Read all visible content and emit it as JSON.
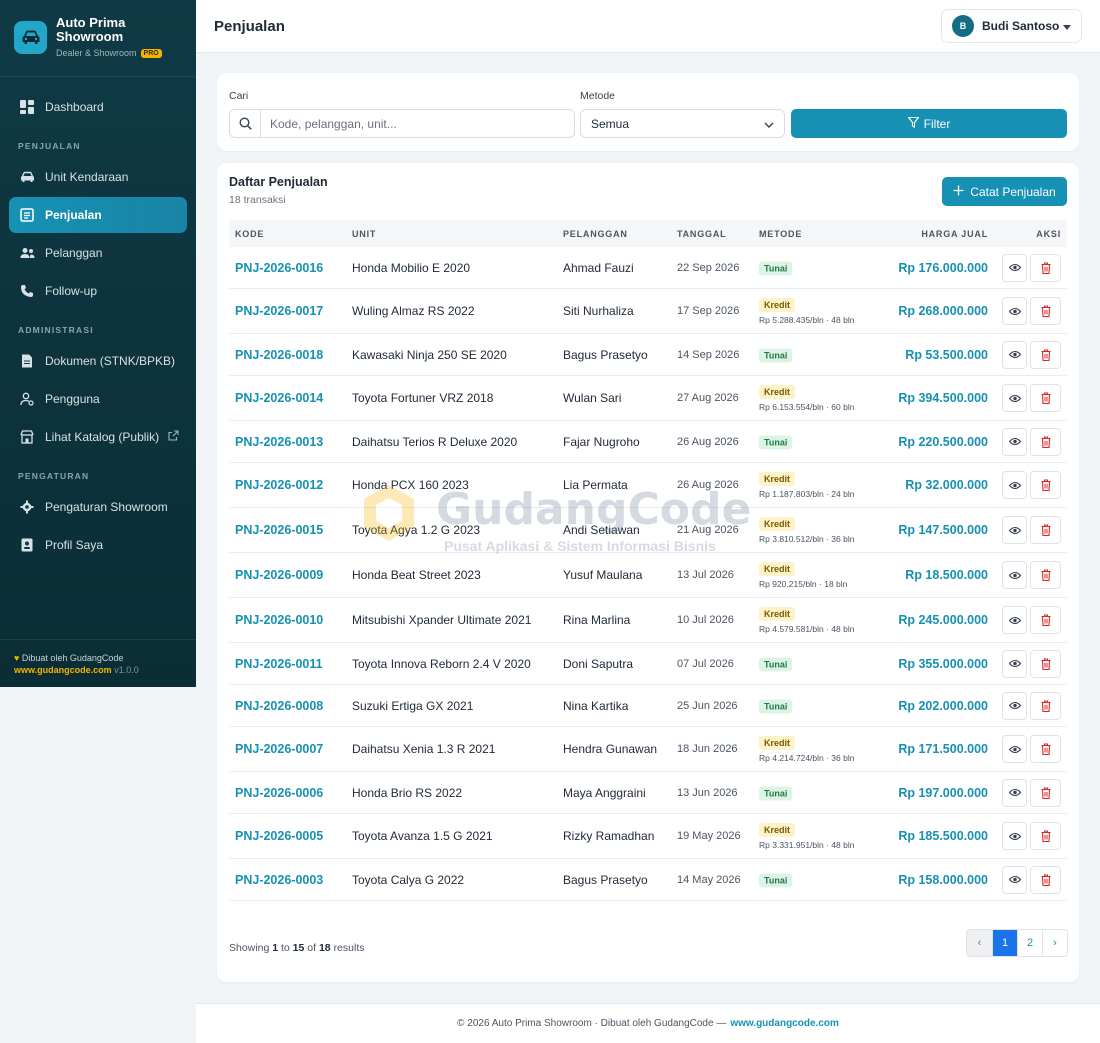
{
  "brand": {
    "name_line1": "Auto Prima",
    "name_line2": "Showroom",
    "subtitle": "Dealer & Showroom",
    "badge": "PRO",
    "icon": "car-icon"
  },
  "sidebar": {
    "dashboard": "Dashboard",
    "section_penjualan": "PENJUALAN",
    "unit_kendaraan": "Unit Kendaraan",
    "penjualan": "Penjualan",
    "pelanggan": "Pelanggan",
    "follow_up": "Follow-up",
    "section_administrasi": "ADMINISTRASI",
    "dokumen": "Dokumen (STNK/BPKB)",
    "pengguna": "Pengguna",
    "katalog": "Lihat Katalog (Publik)",
    "section_pengaturan": "PENGATURAN",
    "pengaturan_showroom": "Pengaturan Showroom",
    "profil": "Profil Saya",
    "footer_made": "Dibuat oleh GudangCode",
    "footer_link": "www.gudangcode.com",
    "footer_version": "v1.0.0"
  },
  "header": {
    "title": "Penjualan",
    "user_initial": "B",
    "user_name": "Budi Santoso"
  },
  "filter": {
    "search_label": "Cari",
    "search_placeholder": "Kode, pelanggan, unit...",
    "method_label": "Metode",
    "method_value": "Semua",
    "filter_button": "Filter"
  },
  "table": {
    "title": "Daftar Penjualan",
    "count": "18 transaksi",
    "add_button": "Catat Penjualan",
    "columns": {
      "kode": "KODE",
      "unit": "UNIT",
      "pelanggan": "PELANGGAN",
      "tanggal": "TANGGAL",
      "metode": "METODE",
      "harga": "HARGA JUAL",
      "aksi": "AKSI"
    },
    "rows": [
      {
        "kode": "PNJ-2026-0016",
        "unit": "Honda Mobilio E 2020",
        "pelanggan": "Ahmad Fauzi",
        "tanggal": "22 Sep 2026",
        "metode": "Tunai",
        "note": "",
        "harga": "Rp 176.000.000"
      },
      {
        "kode": "PNJ-2026-0017",
        "unit": "Wuling Almaz RS 2022",
        "pelanggan": "Siti Nurhaliza",
        "tanggal": "17 Sep 2026",
        "metode": "Kredit",
        "note": "Rp 5.288.435/bln · 48 bln",
        "harga": "Rp 268.000.000"
      },
      {
        "kode": "PNJ-2026-0018",
        "unit": "Kawasaki Ninja 250 SE 2020",
        "pelanggan": "Bagus Prasetyo",
        "tanggal": "14 Sep 2026",
        "metode": "Tunai",
        "note": "",
        "harga": "Rp 53.500.000"
      },
      {
        "kode": "PNJ-2026-0014",
        "unit": "Toyota Fortuner VRZ 2018",
        "pelanggan": "Wulan Sari",
        "tanggal": "27 Aug 2026",
        "metode": "Kredit",
        "note": "Rp 6.153.554/bln · 60 bln",
        "harga": "Rp 394.500.000"
      },
      {
        "kode": "PNJ-2026-0013",
        "unit": "Daihatsu Terios R Deluxe 2020",
        "pelanggan": "Fajar Nugroho",
        "tanggal": "26 Aug 2026",
        "metode": "Tunai",
        "note": "",
        "harga": "Rp 220.500.000"
      },
      {
        "kode": "PNJ-2026-0012",
        "unit": "Honda PCX 160 2023",
        "pelanggan": "Lia Permata",
        "tanggal": "26 Aug 2026",
        "metode": "Kredit",
        "note": "Rp 1.187.803/bln · 24 bln",
        "harga": "Rp 32.000.000"
      },
      {
        "kode": "PNJ-2026-0015",
        "unit": "Toyota Agya 1.2 G 2023",
        "pelanggan": "Andi Setiawan",
        "tanggal": "21 Aug 2026",
        "metode": "Kredit",
        "note": "Rp 3.810.512/bln · 36 bln",
        "harga": "Rp 147.500.000"
      },
      {
        "kode": "PNJ-2026-0009",
        "unit": "Honda Beat Street 2023",
        "pelanggan": "Yusuf Maulana",
        "tanggal": "13 Jul 2026",
        "metode": "Kredit",
        "note": "Rp 920.215/bln · 18 bln",
        "harga": "Rp 18.500.000"
      },
      {
        "kode": "PNJ-2026-0010",
        "unit": "Mitsubishi Xpander Ultimate 2021",
        "pelanggan": "Rina Marlina",
        "tanggal": "10 Jul 2026",
        "metode": "Kredit",
        "note": "Rp 4.579.581/bln · 48 bln",
        "harga": "Rp 245.000.000"
      },
      {
        "kode": "PNJ-2026-0011",
        "unit": "Toyota Innova Reborn 2.4 V 2020",
        "pelanggan": "Doni Saputra",
        "tanggal": "07 Jul 2026",
        "metode": "Tunai",
        "note": "",
        "harga": "Rp 355.000.000"
      },
      {
        "kode": "PNJ-2026-0008",
        "unit": "Suzuki Ertiga GX 2021",
        "pelanggan": "Nina Kartika",
        "tanggal": "25 Jun 2026",
        "metode": "Tunai",
        "note": "",
        "harga": "Rp 202.000.000"
      },
      {
        "kode": "PNJ-2026-0007",
        "unit": "Daihatsu Xenia 1.3 R 2021",
        "pelanggan": "Hendra Gunawan",
        "tanggal": "18 Jun 2026",
        "metode": "Kredit",
        "note": "Rp 4.214.724/bln · 36 bln",
        "harga": "Rp 171.500.000"
      },
      {
        "kode": "PNJ-2026-0006",
        "unit": "Honda Brio RS 2022",
        "pelanggan": "Maya Anggraini",
        "tanggal": "13 Jun 2026",
        "metode": "Tunai",
        "note": "",
        "harga": "Rp 197.000.000"
      },
      {
        "kode": "PNJ-2026-0005",
        "unit": "Toyota Avanza 1.5 G 2021",
        "pelanggan": "Rizky Ramadhan",
        "tanggal": "19 May 2026",
        "metode": "Kredit",
        "note": "Rp 3.331.951/bln · 48 bln",
        "harga": "Rp 185.500.000"
      },
      {
        "kode": "PNJ-2026-0003",
        "unit": "Toyota Calya G 2022",
        "pelanggan": "Bagus Prasetyo",
        "tanggal": "14 May 2026",
        "metode": "Tunai",
        "note": "",
        "harga": "Rp 158.000.000"
      }
    ]
  },
  "pagination": {
    "showing_prefix": "Showing",
    "from": "1",
    "to_word": "to",
    "to": "15",
    "of_word": "of",
    "total": "18",
    "suffix": "results",
    "prev": "‹",
    "pages": [
      "1",
      "2"
    ],
    "next": "›"
  },
  "footer": {
    "text": "© 2026 Auto Prima Showroom · Dibuat oleh GudangCode —",
    "link": "www.gudangcode.com"
  },
  "watermark": {
    "title": "GudangCode",
    "subtitle": "Pusat Aplikasi & Sistem Informasi Bisnis"
  },
  "colors": {
    "accent": "#1691b3",
    "sidebar_bg": "#0f3a45",
    "tunai_bg": "#dcf3e6",
    "kredit_bg": "#fdf2c8",
    "delete": "#dc2626"
  }
}
